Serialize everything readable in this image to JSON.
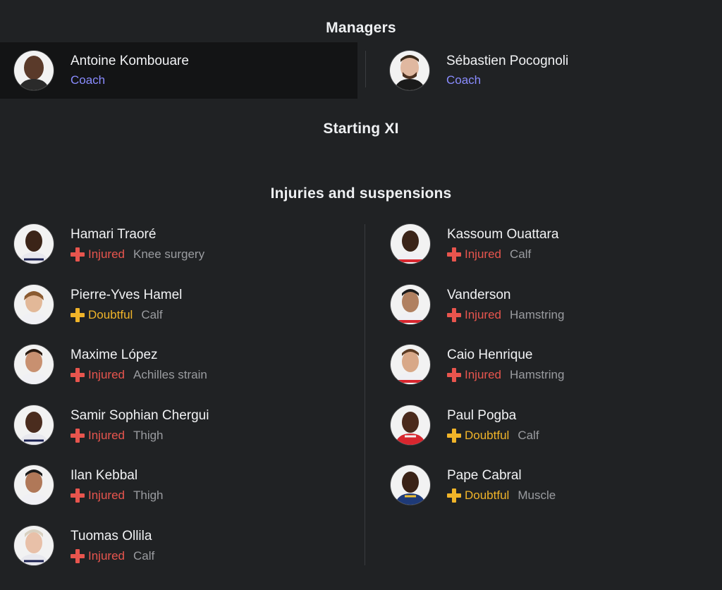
{
  "colors": {
    "background": "#202224",
    "coach_role": "#8a8cff",
    "injured": "#e8554e",
    "doubtful": "#f0b429",
    "reason": "#9a9ca0"
  },
  "managers": {
    "title": "Managers",
    "items": [
      {
        "name": "Antoine Kombouare",
        "role": "Coach"
      },
      {
        "name": "Sébastien Pocognoli",
        "role": "Coach"
      }
    ]
  },
  "starting": {
    "title": "Starting XI"
  },
  "injuries": {
    "title": "Injuries and suspensions",
    "left": [
      {
        "name": "Hamari Traoré",
        "status": "Injured",
        "reason": "Knee surgery"
      },
      {
        "name": "Pierre-Yves Hamel",
        "status": "Doubtful",
        "reason": "Calf"
      },
      {
        "name": "Maxime López",
        "status": "Injured",
        "reason": "Achilles strain"
      },
      {
        "name": "Samir Sophian Chergui",
        "status": "Injured",
        "reason": "Thigh"
      },
      {
        "name": "Ilan Kebbal",
        "status": "Injured",
        "reason": "Thigh"
      },
      {
        "name": "Tuomas Ollila",
        "status": "Injured",
        "reason": "Calf"
      }
    ],
    "right": [
      {
        "name": "Kassoum Ouattara",
        "status": "Injured",
        "reason": "Calf"
      },
      {
        "name": "Vanderson",
        "status": "Injured",
        "reason": "Hamstring"
      },
      {
        "name": "Caio Henrique",
        "status": "Injured",
        "reason": "Hamstring"
      },
      {
        "name": "Paul Pogba",
        "status": "Doubtful",
        "reason": "Calf"
      },
      {
        "name": "Pape Cabral",
        "status": "Doubtful",
        "reason": "Muscle"
      }
    ]
  }
}
